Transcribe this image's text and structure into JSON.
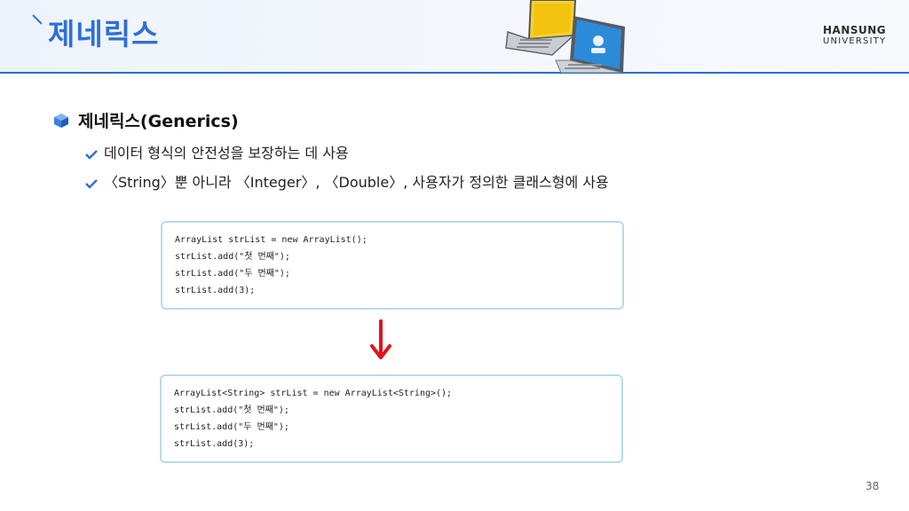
{
  "slide": {
    "title": "제네릭스",
    "page_number": "38"
  },
  "logo": {
    "line1": "HANSUNG",
    "line2": "UNIVERSITY"
  },
  "content": {
    "heading": "제네릭스(Generics)",
    "bullets": [
      "데이터 형식의 안전성을 보장하는 데 사용",
      "〈String〉뿐 아니라 〈Integer〉, 〈Double〉, 사용자가 정의한 클래스형에 사용"
    ]
  },
  "code_before": [
    "ArrayList strList = new ArrayList();",
    "strList.add(\"첫 번째\");",
    "strList.add(\"두 번째\");",
    "strList.add(3);"
  ],
  "code_after": [
    "ArrayList<String> strList = new ArrayList<String>();",
    "strList.add(\"첫 번째\");",
    "strList.add(\"두 번째\");",
    "strList.add(3);"
  ],
  "colors": {
    "accent": "#2f6fd6",
    "arrow": "#e0141e",
    "code_border": "#b9dbe6"
  },
  "icons": [
    "laptops-illustration",
    "cube-bullet-icon",
    "check-icon",
    "down-arrow-icon"
  ]
}
